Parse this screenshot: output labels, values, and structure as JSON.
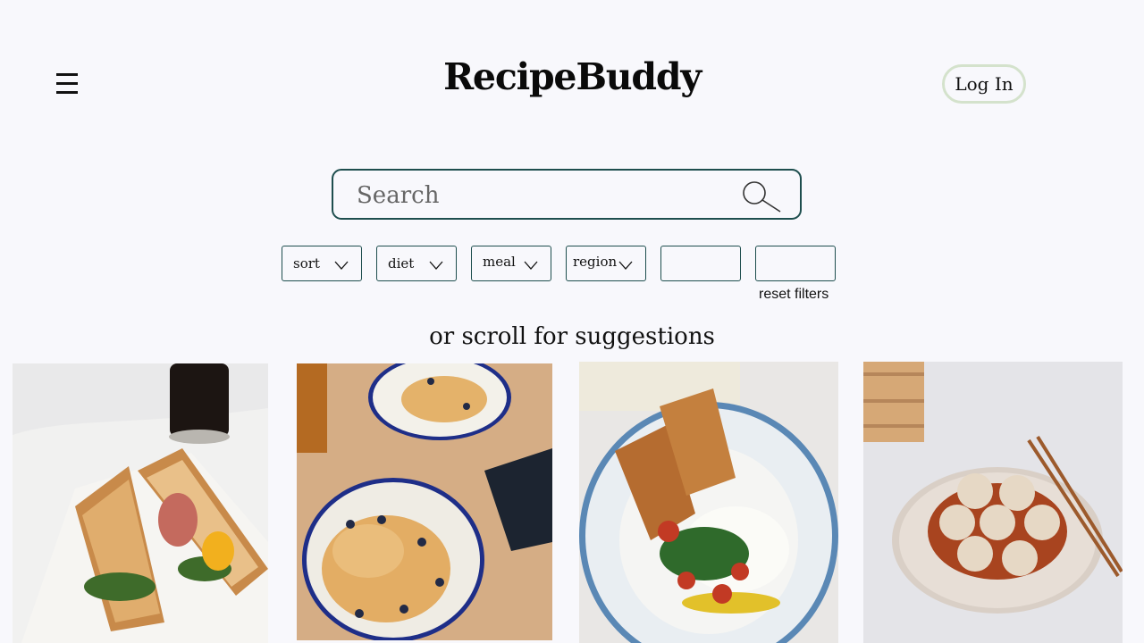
{
  "header": {
    "menu_icon": "hamburger-menu-icon",
    "logo": "RecipeBuddy",
    "login_label": "Log In"
  },
  "search": {
    "placeholder": "Search",
    "icon": "search-icon"
  },
  "filters": [
    {
      "label": "sort",
      "icon": "chevron-down-icon"
    },
    {
      "label": "diet",
      "icon": "chevron-down-icon"
    },
    {
      "label": "meal",
      "icon": "chevron-down-icon"
    },
    {
      "label": "region",
      "icon": "chevron-down-icon"
    },
    {
      "label": ""
    },
    {
      "label": ""
    }
  ],
  "reset_label": "reset filters",
  "suggestions_heading": "or scroll for suggestions",
  "recipes": [
    {
      "image": "toasted sandwich with fried egg and coffee"
    },
    {
      "image": "blueberry pancakes with banana"
    },
    {
      "image": "burrata with tomatoes, basil and toast"
    },
    {
      "image": "soup dumplings with chopsticks"
    }
  ],
  "colors": {
    "background": "#f8f8fc",
    "accent": "#1e4e4e",
    "login_border": "#d4e2cc"
  }
}
